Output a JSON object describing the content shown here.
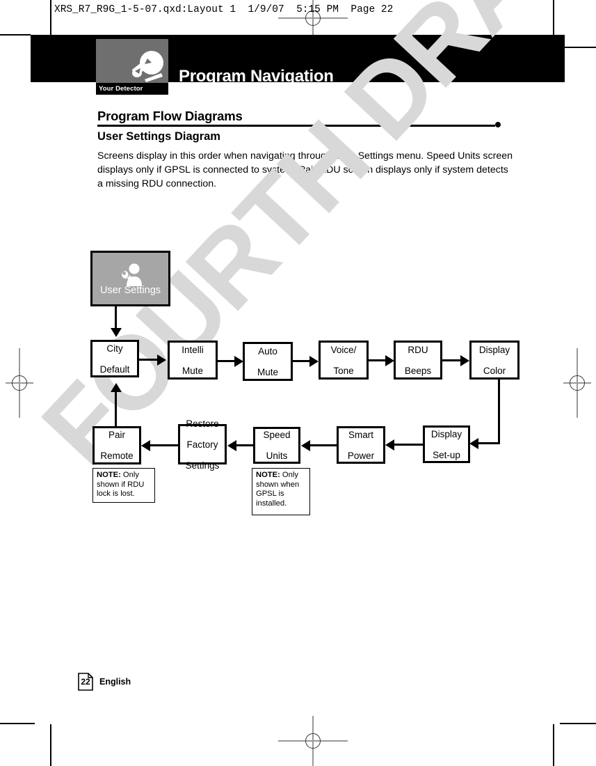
{
  "file_header": {
    "filename": "XRS_R7_R9G_1-5-07.qxd:Layout 1",
    "date": "1/9/07",
    "time": "5:15 PM",
    "page_label": "Page 22"
  },
  "banner": {
    "title": "Program Navigation",
    "badge_label": "Your Detector",
    "badge_icon": "radar-detector-icon",
    "background_color": "#000000",
    "badge_color": "#6f6f6f"
  },
  "section": {
    "title": "Program Flow Diagrams",
    "subtitle": "User Settings Diagram",
    "intro": "Screens display in this order when navigating through User Settings menu. Speed Units screen displays only if GPSL is connected to system. Pair RDU screen displays only if system detects a missing RDU connection."
  },
  "watermark": {
    "text": "FOURTH DRAFT",
    "color": "#d8d8d8"
  },
  "chart_data": {
    "type": "diagram",
    "title": "User Settings Diagram",
    "start_node": {
      "label": "User Settings",
      "icon": "user-settings-icon",
      "fill": "#a6a6a6",
      "text_color": "#ffffff"
    },
    "nodes": [
      {
        "id": "city-default",
        "label": "City\nDefault",
        "line1": "City",
        "line2": "Default",
        "line3": "",
        "row": "top"
      },
      {
        "id": "intelli-mute",
        "label": "Intelli\nMute",
        "line1": "Intelli",
        "line2": "Mute",
        "line3": "",
        "row": "top"
      },
      {
        "id": "auto-mute",
        "label": "Auto\nMute",
        "line1": "Auto",
        "line2": "Mute",
        "line3": "",
        "row": "top"
      },
      {
        "id": "voice-tone",
        "label": "Voice/\nTone",
        "line1": "Voice/",
        "line2": "Tone",
        "line3": "",
        "row": "top"
      },
      {
        "id": "rdu-beeps",
        "label": "RDU\nBeeps",
        "line1": "RDU",
        "line2": "Beeps",
        "line3": "",
        "row": "top"
      },
      {
        "id": "display-color",
        "label": "Display\nColor",
        "line1": "Display",
        "line2": "Color",
        "line3": "",
        "row": "top"
      },
      {
        "id": "display-setup",
        "label": "Display\nSet-up",
        "line1": "Display",
        "line2": "Set-up",
        "line3": "",
        "row": "bottom"
      },
      {
        "id": "smart-power",
        "label": "Smart\nPower",
        "line1": "Smart",
        "line2": "Power",
        "line3": "",
        "row": "bottom"
      },
      {
        "id": "speed-units",
        "label": "Speed\nUnits",
        "line1": "Speed",
        "line2": "Units",
        "line3": "",
        "row": "bottom"
      },
      {
        "id": "restore-factory",
        "label": "Restore\nFactory\nSettings",
        "line1": "Restore",
        "line2": "Factory",
        "line3": "Settings",
        "row": "bottom"
      },
      {
        "id": "pair-remote",
        "label": "Pair\nRemote",
        "line1": "Pair",
        "line2": "Remote",
        "line3": "",
        "row": "bottom"
      }
    ],
    "edges": [
      {
        "from": "user-settings",
        "to": "city-default",
        "direction": "down"
      },
      {
        "from": "city-default",
        "to": "intelli-mute",
        "direction": "right"
      },
      {
        "from": "intelli-mute",
        "to": "auto-mute",
        "direction": "right"
      },
      {
        "from": "auto-mute",
        "to": "voice-tone",
        "direction": "right"
      },
      {
        "from": "voice-tone",
        "to": "rdu-beeps",
        "direction": "right"
      },
      {
        "from": "rdu-beeps",
        "to": "display-color",
        "direction": "right"
      },
      {
        "from": "display-color",
        "to": "display-setup",
        "direction": "down-left"
      },
      {
        "from": "display-setup",
        "to": "smart-power",
        "direction": "left"
      },
      {
        "from": "smart-power",
        "to": "speed-units",
        "direction": "left"
      },
      {
        "from": "speed-units",
        "to": "restore-factory",
        "direction": "left"
      },
      {
        "from": "restore-factory",
        "to": "pair-remote",
        "direction": "left"
      },
      {
        "from": "pair-remote",
        "to": "city-default",
        "direction": "up"
      }
    ],
    "notes": [
      {
        "id": "note-pair-remote",
        "bold": "NOTE:",
        "text": " Only shown if RDU lock is lost.",
        "attached_to": "pair-remote"
      },
      {
        "id": "note-speed-units",
        "bold": "NOTE:",
        "text": " Only shown when GPSL is installed.",
        "attached_to": "speed-units"
      }
    ]
  },
  "footer": {
    "page_number": "22",
    "language": "English"
  }
}
